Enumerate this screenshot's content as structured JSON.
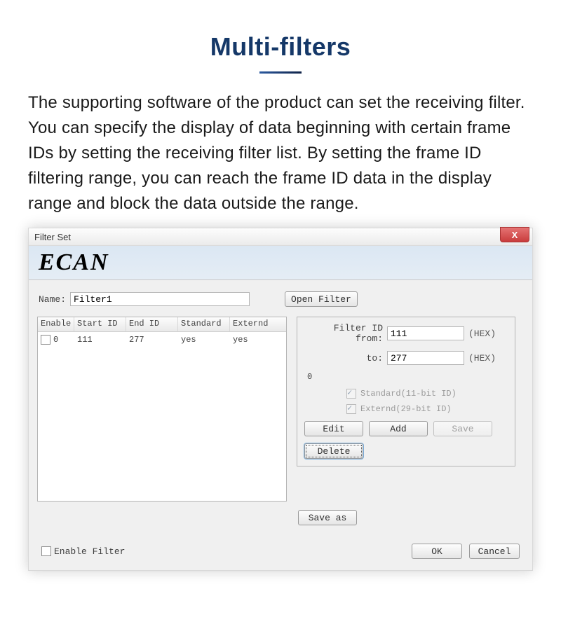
{
  "page": {
    "heading": "Multi-filters",
    "description": "The supporting software of the product can set the receiving filter. You can specify the display of data beginning with certain frame IDs by setting the receiving filter list. By setting the frame ID filtering range, you can reach the frame ID data in the display range and block the data outside the range."
  },
  "dialog": {
    "title": "Filter Set",
    "banner": "ECAN",
    "name_label": "Name:",
    "name_value": "Filter1",
    "open_filter_btn": "Open Filter",
    "table": {
      "headers": {
        "enable": "Enable",
        "start_id": "Start ID",
        "end_id": "End ID",
        "standard": "Standard",
        "externd": "Externd"
      },
      "rows": [
        {
          "enable_checked": false,
          "index": "0",
          "start_id": "111",
          "end_id": "277",
          "standard": "yes",
          "externd": "yes"
        }
      ]
    },
    "filter_panel": {
      "from_label": "Filter ID from:",
      "from_value": "111",
      "to_label": "to:",
      "to_value": "277",
      "hex_label": "(HEX)",
      "zero_label": "0",
      "standard_label": "Standard(11-bit ID)",
      "externd_label": "Externd(29-bit ID)",
      "standard_checked": true,
      "externd_checked": true,
      "edit_btn": "Edit",
      "add_btn": "Add",
      "save_btn": "Save",
      "delete_btn": "Delete"
    },
    "save_as_btn": "Save as",
    "enable_filter_label": "Enable Filter",
    "enable_filter_checked": false,
    "ok_btn": "OK",
    "cancel_btn": "Cancel"
  }
}
